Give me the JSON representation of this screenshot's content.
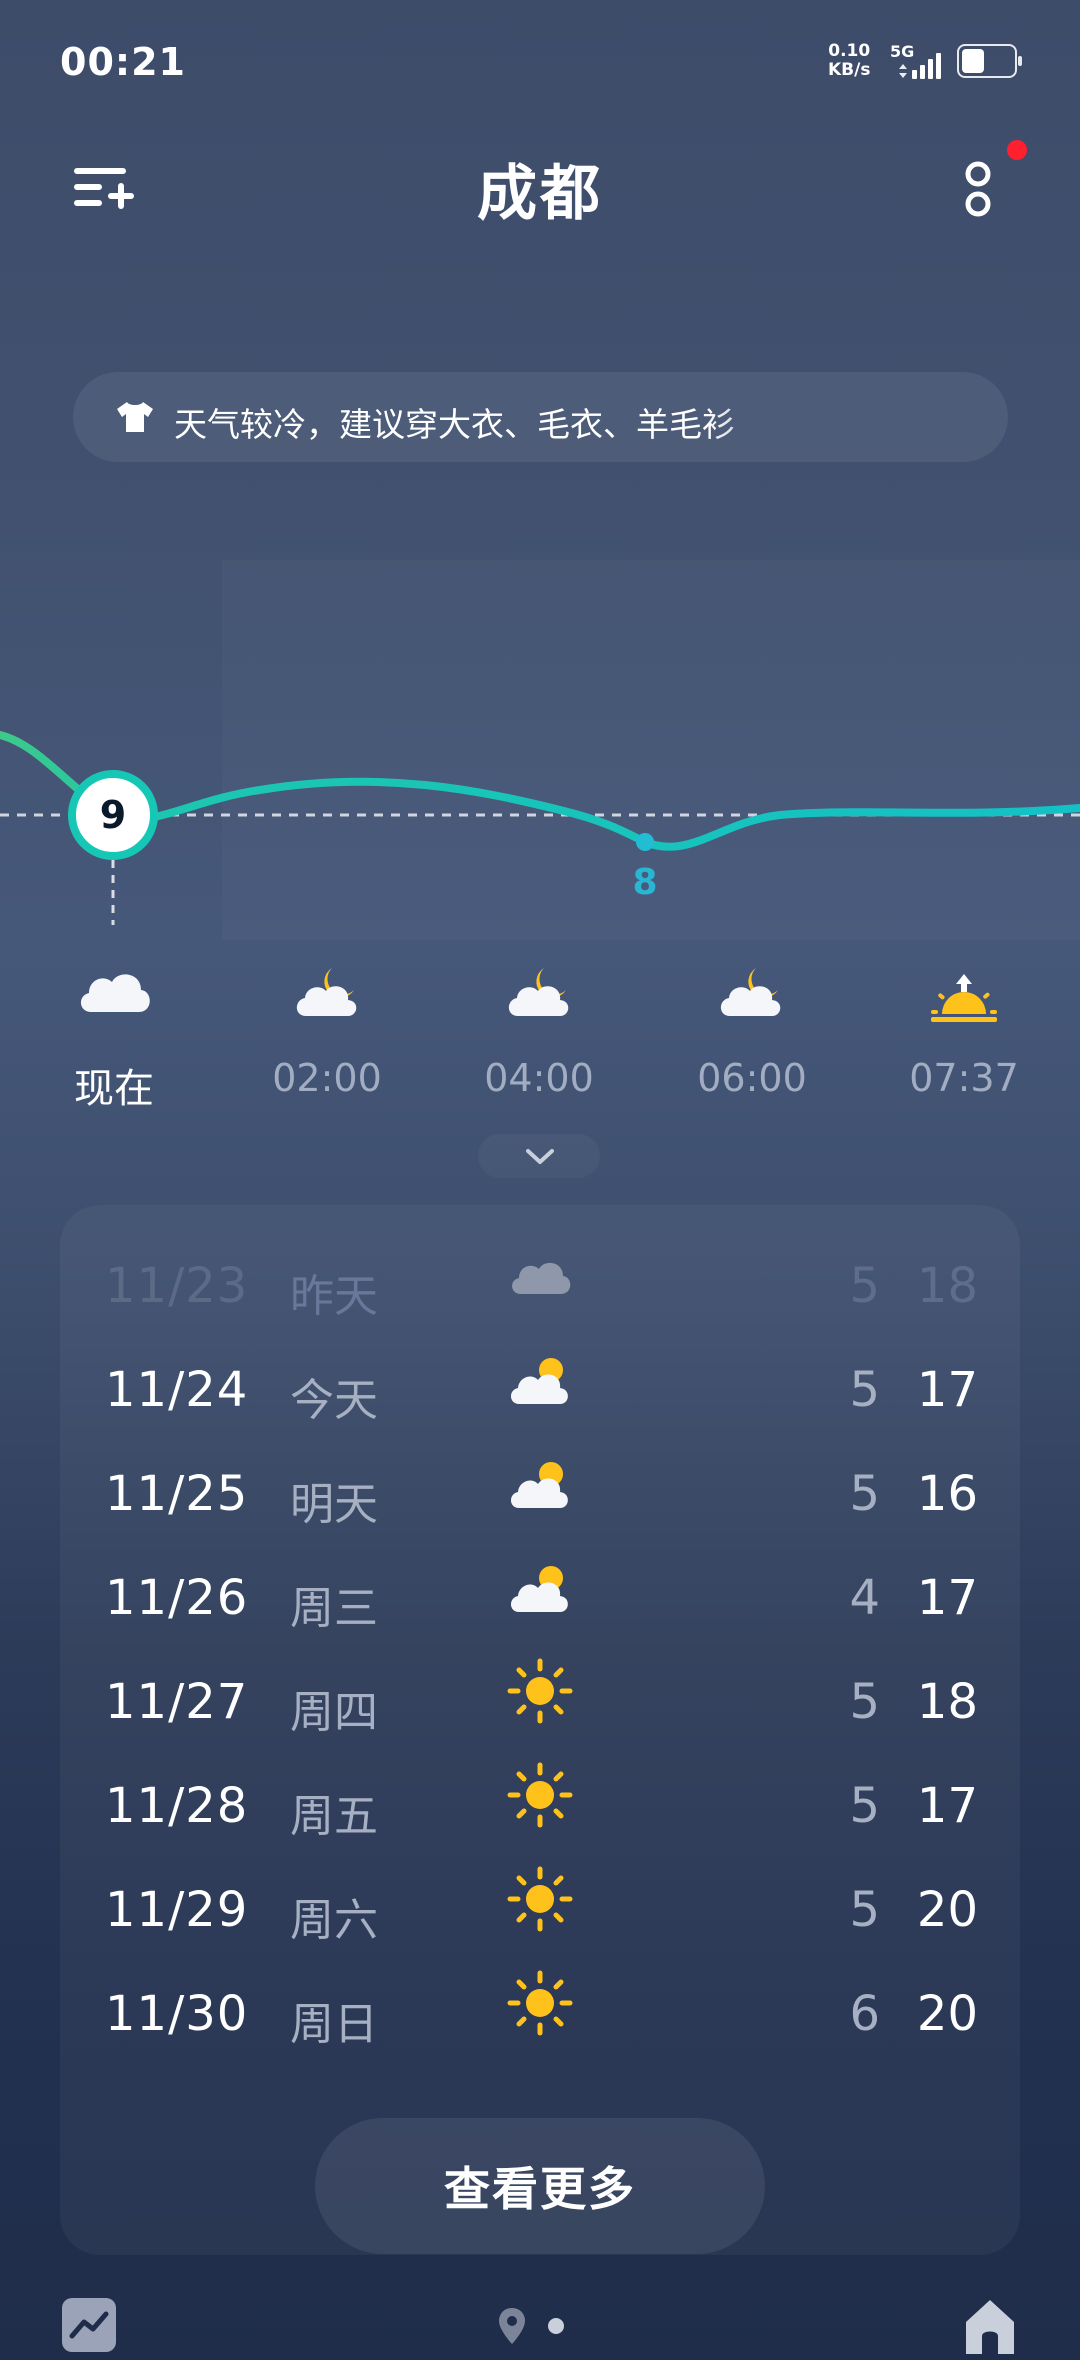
{
  "status_bar": {
    "time": "00:21",
    "net_speed_value": "0.10",
    "net_speed_unit": "KB/s",
    "network": "5G",
    "icons": [
      "signal-icon",
      "battery-icon"
    ]
  },
  "header": {
    "city": "成都",
    "menu_icon": "add-city-menu-icon",
    "more_icon": "more-options-icon"
  },
  "tip": {
    "icon": "tshirt-icon",
    "text": "天气较冷，建议穿大衣、毛衣、羊毛衫"
  },
  "chart": {
    "current_temp": "9",
    "low_label": "8"
  },
  "hourly": [
    {
      "time": "现在",
      "icon": "cloudy-icon"
    },
    {
      "time": "02:00",
      "icon": "cloudy-night-icon"
    },
    {
      "time": "04:00",
      "icon": "cloudy-night-icon"
    },
    {
      "time": "06:00",
      "icon": "cloudy-night-icon"
    },
    {
      "time": "07:37",
      "icon": "sunrise-icon"
    }
  ],
  "daily": [
    {
      "date": "11/23",
      "day": "昨天",
      "icon": "cloudy-icon",
      "low": "5",
      "high": "18"
    },
    {
      "date": "11/24",
      "day": "今天",
      "icon": "partly-cloudy-icon",
      "low": "5",
      "high": "17"
    },
    {
      "date": "11/25",
      "day": "明天",
      "icon": "partly-cloudy-icon",
      "low": "5",
      "high": "16"
    },
    {
      "date": "11/26",
      "day": "周三",
      "icon": "partly-cloudy-icon",
      "low": "4",
      "high": "17"
    },
    {
      "date": "11/27",
      "day": "周四",
      "icon": "sunny-icon",
      "low": "5",
      "high": "18"
    },
    {
      "date": "11/28",
      "day": "周五",
      "icon": "sunny-icon",
      "low": "5",
      "high": "17"
    },
    {
      "date": "11/29",
      "day": "周六",
      "icon": "sunny-icon",
      "low": "5",
      "high": "20"
    },
    {
      "date": "11/30",
      "day": "周日",
      "icon": "sunny-icon",
      "low": "6",
      "high": "20"
    }
  ],
  "more_button": "查看更多",
  "bottom_bar": {
    "icons": [
      "trend-icon",
      "location-icon",
      "home-icon"
    ]
  },
  "colors": {
    "accent_teal": "#16c7b5",
    "sun_yellow": "#ffc21a",
    "notification_red": "#ff1f2e"
  }
}
